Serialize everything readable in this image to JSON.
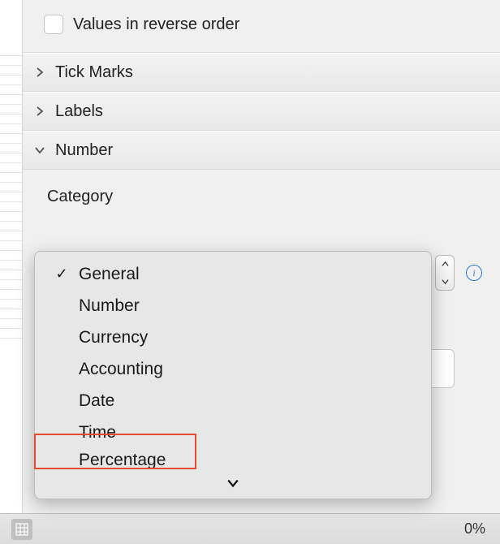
{
  "checkbox": {
    "label": "Values in reverse order",
    "checked": false
  },
  "sections": {
    "tick_marks": {
      "label": "Tick Marks",
      "expanded": false
    },
    "labels": {
      "label": "Labels",
      "expanded": false
    },
    "number": {
      "label": "Number",
      "expanded": true
    }
  },
  "category": {
    "heading": "Category",
    "options": [
      {
        "label": "General",
        "selected": true
      },
      {
        "label": "Number",
        "selected": false
      },
      {
        "label": "Currency",
        "selected": false
      },
      {
        "label": "Accounting",
        "selected": false
      },
      {
        "label": "Date",
        "selected": false
      },
      {
        "label": "Time",
        "selected": false
      },
      {
        "label": "Percentage",
        "selected": false
      }
    ]
  },
  "bottom": {
    "zoom": "0%"
  }
}
